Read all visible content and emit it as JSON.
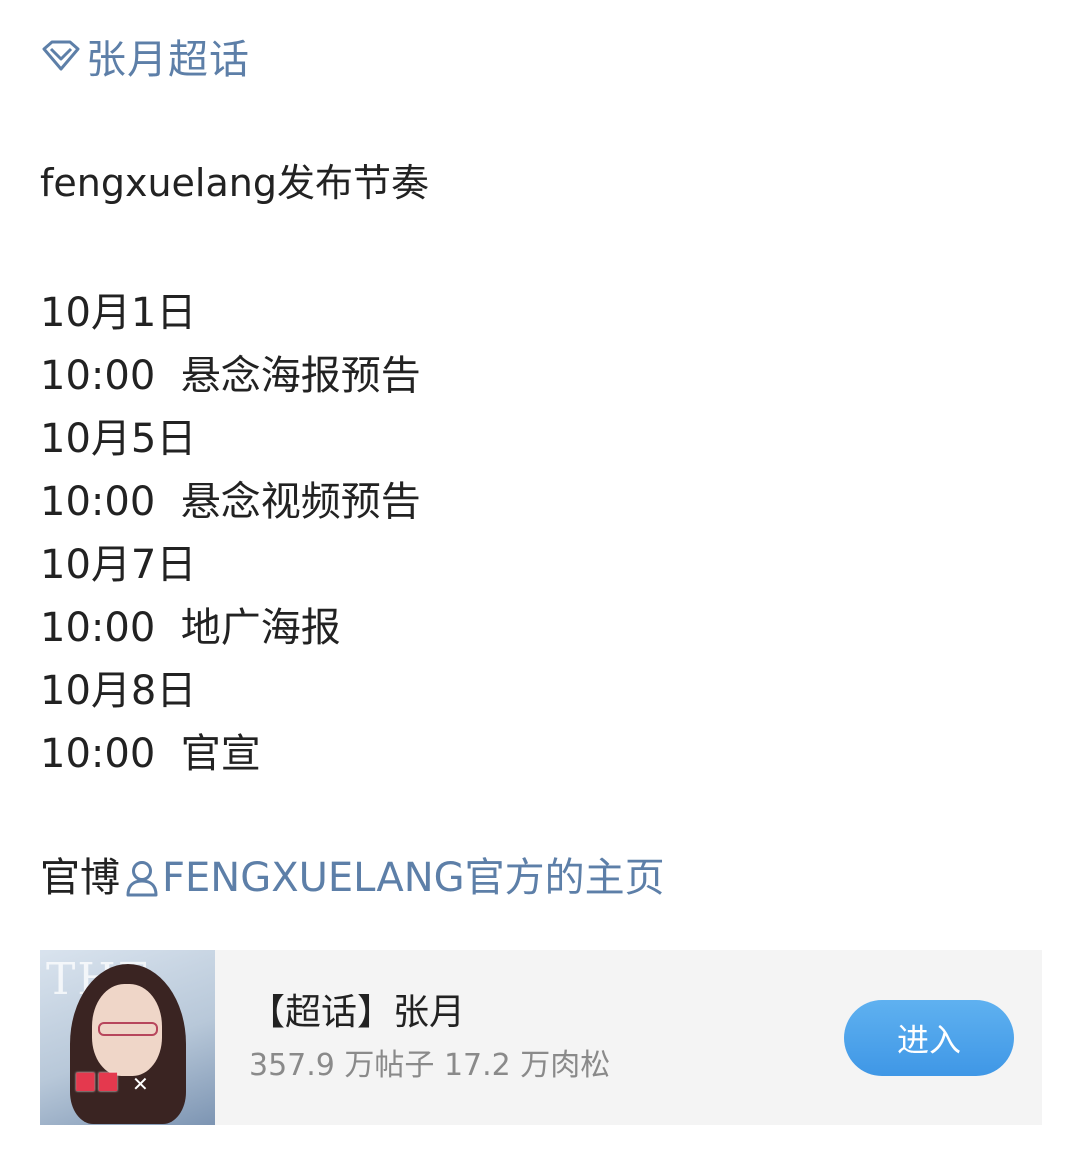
{
  "topic": {
    "icon": "diamond-icon",
    "label": "张月超话",
    "color": "#5d7fa8"
  },
  "post": {
    "title": "fengxuelang发布节奏",
    "schedule": [
      "10月1日",
      "10:00  悬念海报预告",
      "10月5日",
      "10:00  悬念视频预告",
      "10月7日",
      "10:00  地广海报",
      "10月8日",
      "10:00  官宣"
    ],
    "official": {
      "prefix": "官博",
      "link_icon": "user-icon",
      "link_text": "FENGXUELANG官方的主页"
    }
  },
  "card": {
    "name": "【超话】张月",
    "stats": "357.9 万帖子 17.2 万肉松",
    "enter_label": "进入",
    "button_color": "#4aa3ea"
  }
}
